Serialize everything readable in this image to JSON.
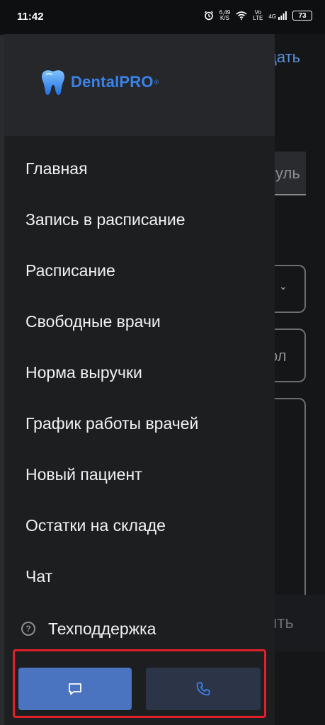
{
  "status_bar": {
    "time": "11:42",
    "speed_value": "6,49",
    "speed_unit": "K/S",
    "volte_top": "Vo",
    "volte_bottom": "LTE",
    "network": "4G",
    "battery": "73"
  },
  "background": {
    "header_action": "дать",
    "search_text": "суль",
    "input_text": "ол",
    "submit_text": "ить"
  },
  "drawer": {
    "logo": {
      "text": "DentalPRO",
      "reg_mark": "®"
    },
    "menu": [
      {
        "label": "Главная"
      },
      {
        "label": "Запись в расписание"
      },
      {
        "label": "Расписание"
      },
      {
        "label": "Свободные врачи"
      },
      {
        "label": "Норма выручки"
      },
      {
        "label": "График работы врачей"
      },
      {
        "label": "Новый пациент"
      },
      {
        "label": "Остатки на складе"
      },
      {
        "label": "Чат"
      }
    ],
    "support": {
      "icon_glyph": "?",
      "label": "Техподдержка"
    },
    "actions": {
      "chat_icon": "chat-bubble-icon",
      "call_icon": "phone-icon"
    }
  },
  "colors": {
    "drawer_bg": "#1d1e20",
    "accent": "#3a82e8",
    "chat_button": "#4a73c0",
    "call_button": "#2c3448",
    "highlight_border": "#e0202a"
  }
}
